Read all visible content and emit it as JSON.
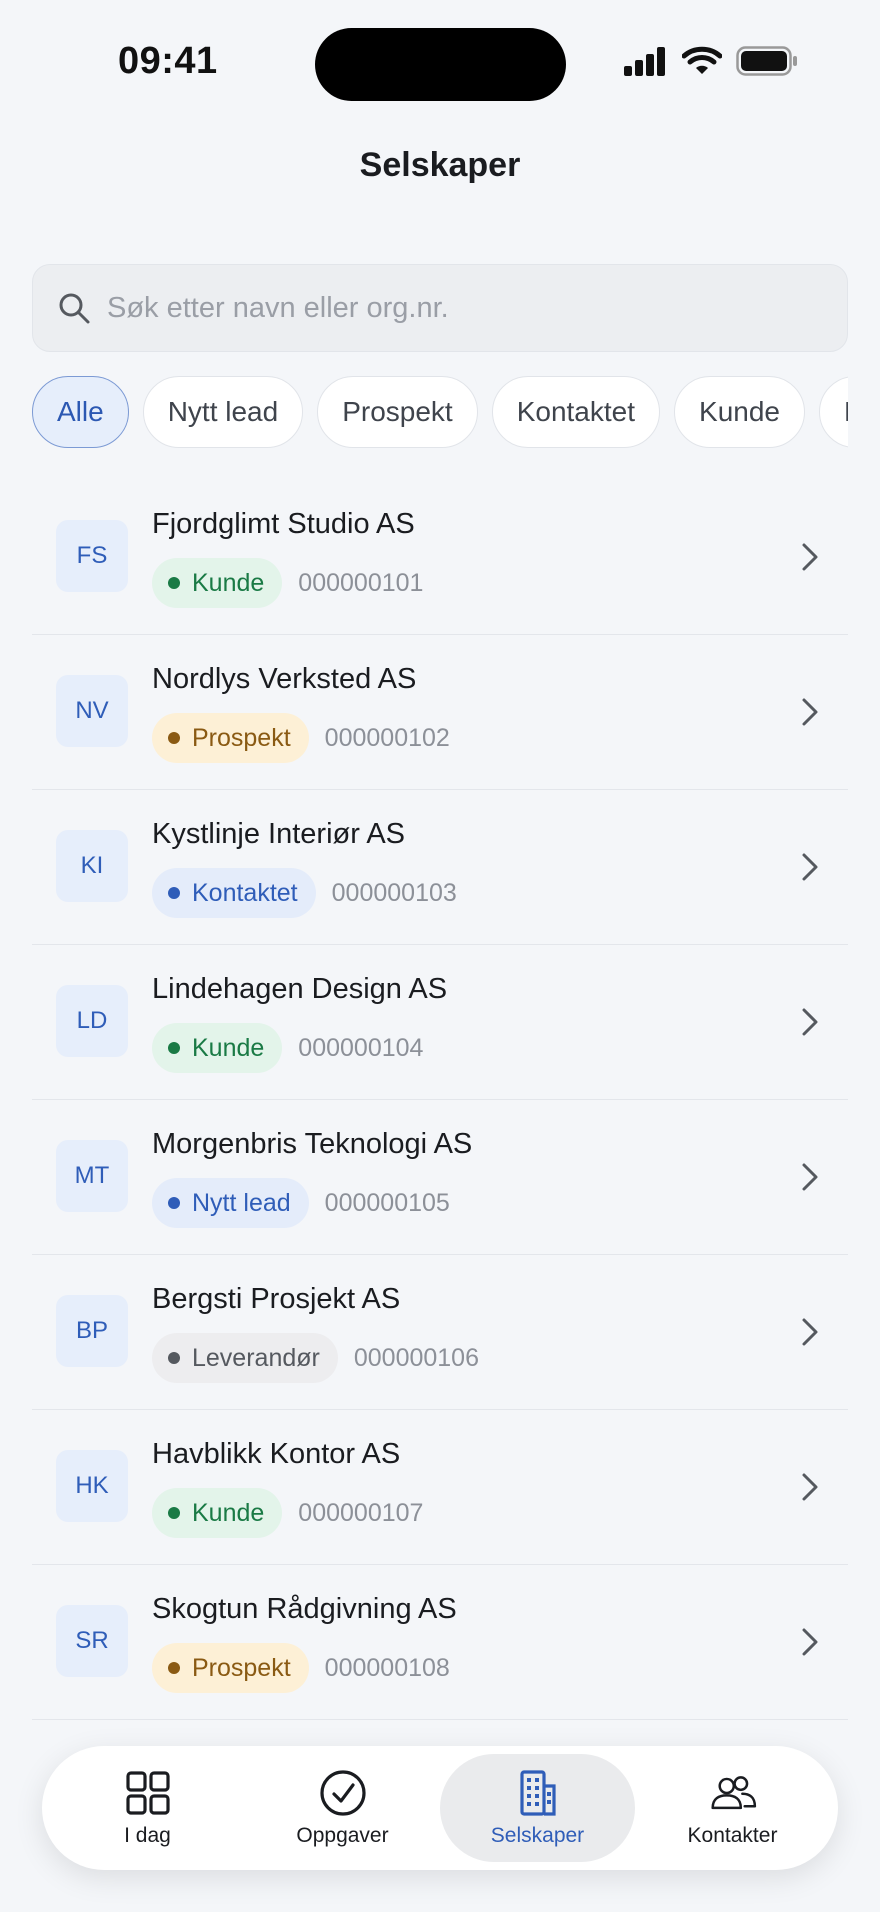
{
  "status_bar": {
    "time": "09:41"
  },
  "header": {
    "title": "Selskaper"
  },
  "search": {
    "placeholder": "Søk etter navn eller org.nr."
  },
  "filters": [
    "Alle",
    "Nytt lead",
    "Prospekt",
    "Kontaktet",
    "Kunde",
    "Leverandør"
  ],
  "active_filter": "Alle",
  "companies": [
    {
      "initials": "FS",
      "name": "Fjordglimt Studio AS",
      "status": "Kunde",
      "orgnr": "000000101"
    },
    {
      "initials": "NV",
      "name": "Nordlys Verksted AS",
      "status": "Prospekt",
      "orgnr": "000000102"
    },
    {
      "initials": "KI",
      "name": "Kystlinje Interiør AS",
      "status": "Kontaktet",
      "orgnr": "000000103"
    },
    {
      "initials": "LD",
      "name": "Lindehagen Design AS",
      "status": "Kunde",
      "orgnr": "000000104"
    },
    {
      "initials": "MT",
      "name": "Morgenbris Teknologi AS",
      "status": "Nytt lead",
      "orgnr": "000000105"
    },
    {
      "initials": "BP",
      "name": "Bergsti Prosjekt AS",
      "status": "Leverandør",
      "orgnr": "000000106"
    },
    {
      "initials": "HK",
      "name": "Havblikk Kontor AS",
      "status": "Kunde",
      "orgnr": "000000107"
    },
    {
      "initials": "SR",
      "name": "Skogtun Rådgivning AS",
      "status": "Prospekt",
      "orgnr": "000000108"
    }
  ],
  "tabs": [
    {
      "label": "I dag",
      "icon": "grid-icon"
    },
    {
      "label": "Oppgaver",
      "icon": "check-circle-icon"
    },
    {
      "label": "Selskaper",
      "icon": "building-icon"
    },
    {
      "label": "Kontakter",
      "icon": "users-icon"
    }
  ],
  "active_tab": "Selskaper",
  "colors": {
    "accent": "#2f5db8",
    "kunde": "#1a7a45",
    "prospekt": "#8a5a13",
    "kontaktet": "#2f5db8",
    "leverandor": "#55595f"
  }
}
